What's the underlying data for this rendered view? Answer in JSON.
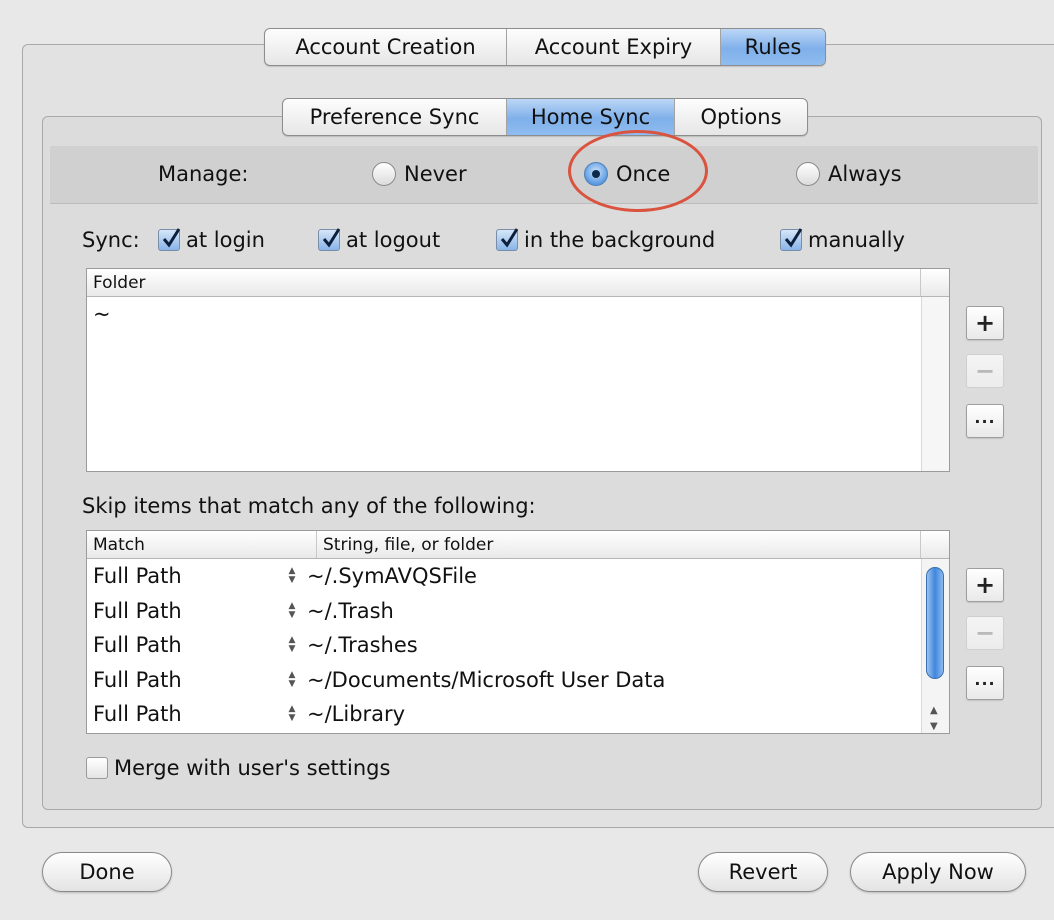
{
  "top_tabs": [
    "Account Creation",
    "Account Expiry",
    "Rules"
  ],
  "top_tabs_selected": "Rules",
  "sub_tabs": [
    "Preference Sync",
    "Home Sync",
    "Options"
  ],
  "sub_tabs_selected": "Home Sync",
  "manage": {
    "label": "Manage:",
    "options": [
      "Never",
      "Once",
      "Always"
    ],
    "selected": "Once"
  },
  "sync": {
    "label": "Sync:",
    "options": [
      {
        "label": "at login",
        "checked": true
      },
      {
        "label": "at logout",
        "checked": true
      },
      {
        "label": "in the background",
        "checked": true
      },
      {
        "label": "manually",
        "checked": true
      }
    ]
  },
  "folder_table": {
    "header": "Folder",
    "rows": [
      "~"
    ]
  },
  "skip": {
    "label": "Skip items that match any of the following:",
    "columns": [
      "Match",
      "String, file, or folder"
    ],
    "rows": [
      {
        "match": "Full Path",
        "value": "~/.SymAVQSFile"
      },
      {
        "match": "Full Path",
        "value": "~/.Trash"
      },
      {
        "match": "Full Path",
        "value": "~/.Trashes"
      },
      {
        "match": "Full Path",
        "value": "~/Documents/Microsoft User Data"
      },
      {
        "match": "Full Path",
        "value": "~/Library"
      }
    ]
  },
  "buttons": {
    "add": "+",
    "remove": "−",
    "more": "···",
    "done": "Done",
    "revert": "Revert",
    "apply": "Apply Now"
  },
  "merge": {
    "label": "Merge with user's settings",
    "checked": false
  },
  "colors": {
    "accent": "#7fb0ea",
    "highlight_ring": "#d9533f"
  }
}
